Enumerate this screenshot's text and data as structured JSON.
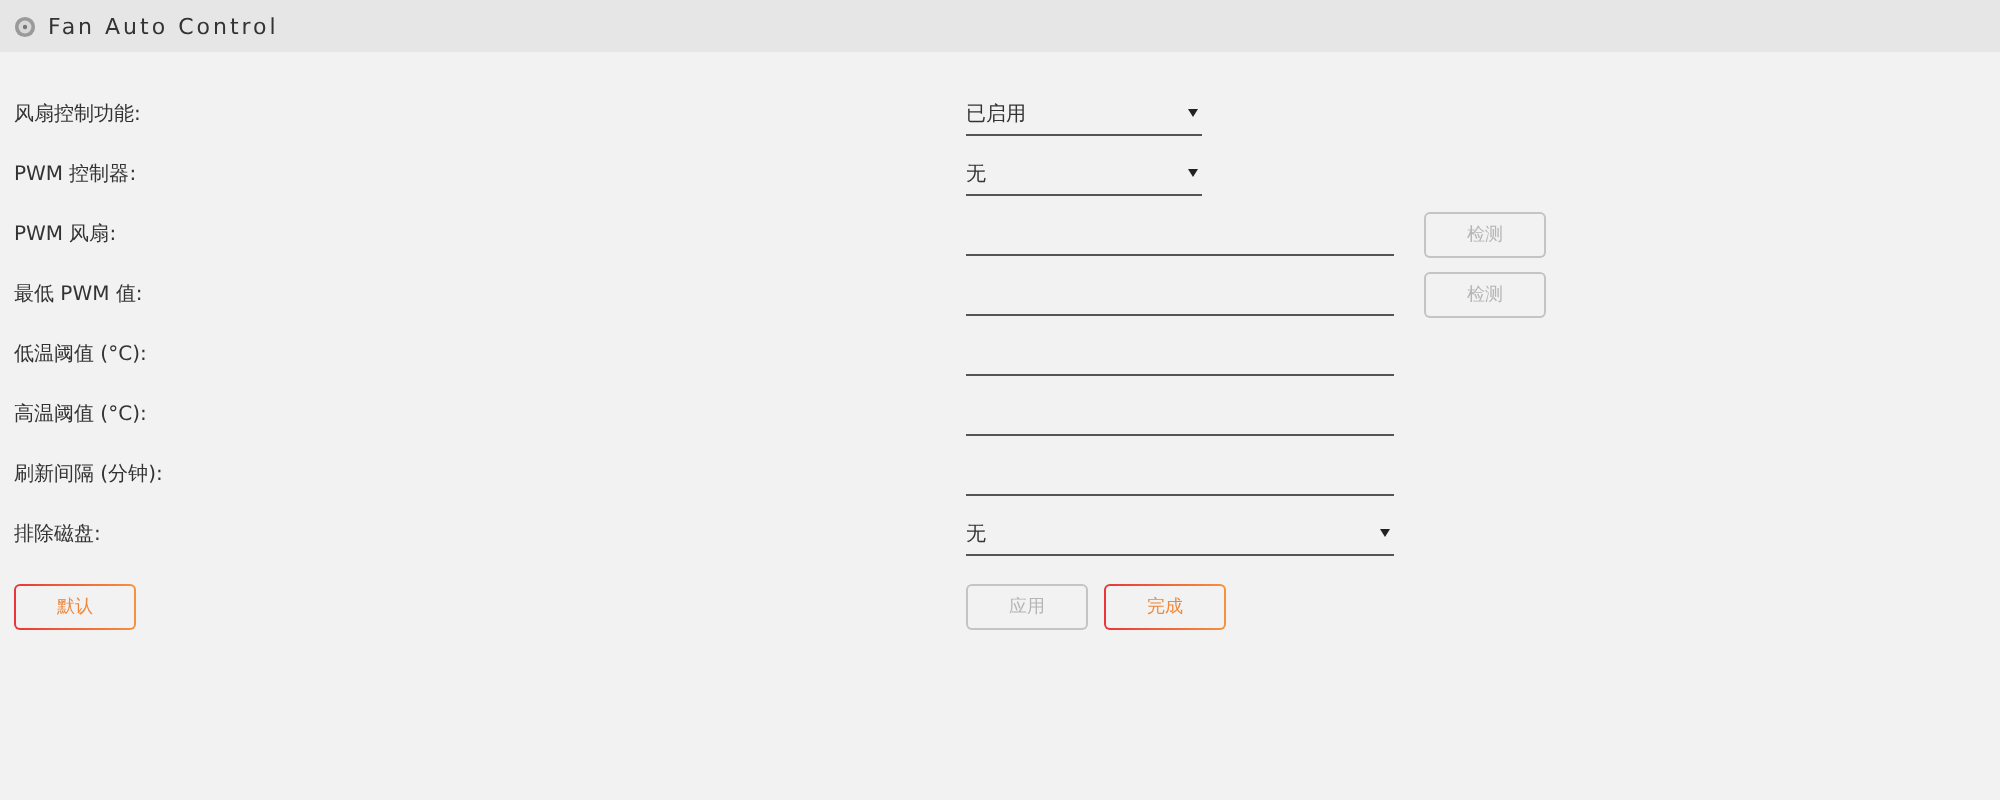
{
  "window": {
    "title": "Fan Auto Control"
  },
  "fields": [
    {
      "label": "风扇控制功能:",
      "kind": "select",
      "value": "已启用",
      "wide": false
    },
    {
      "label": "PWM 控制器:",
      "kind": "select",
      "value": "无",
      "wide": false
    },
    {
      "label": "PWM 风扇:",
      "kind": "input",
      "button": {
        "label": "检测",
        "disabled": true
      }
    },
    {
      "label": "最低 PWM 值:",
      "kind": "input",
      "button": {
        "label": "检测",
        "disabled": true
      }
    },
    {
      "label": "低温阈值 (°C):",
      "kind": "input"
    },
    {
      "label": "高温阈值 (°C):",
      "kind": "input"
    },
    {
      "label": "刷新间隔 (分钟):",
      "kind": "input"
    },
    {
      "label": "排除磁盘:",
      "kind": "select",
      "value": "无",
      "wide": true
    }
  ],
  "left_buttons": [
    {
      "label": "默认",
      "disabled": false
    }
  ],
  "right_buttons": [
    {
      "label": "应用",
      "disabled": true
    },
    {
      "label": "完成",
      "disabled": false
    }
  ]
}
